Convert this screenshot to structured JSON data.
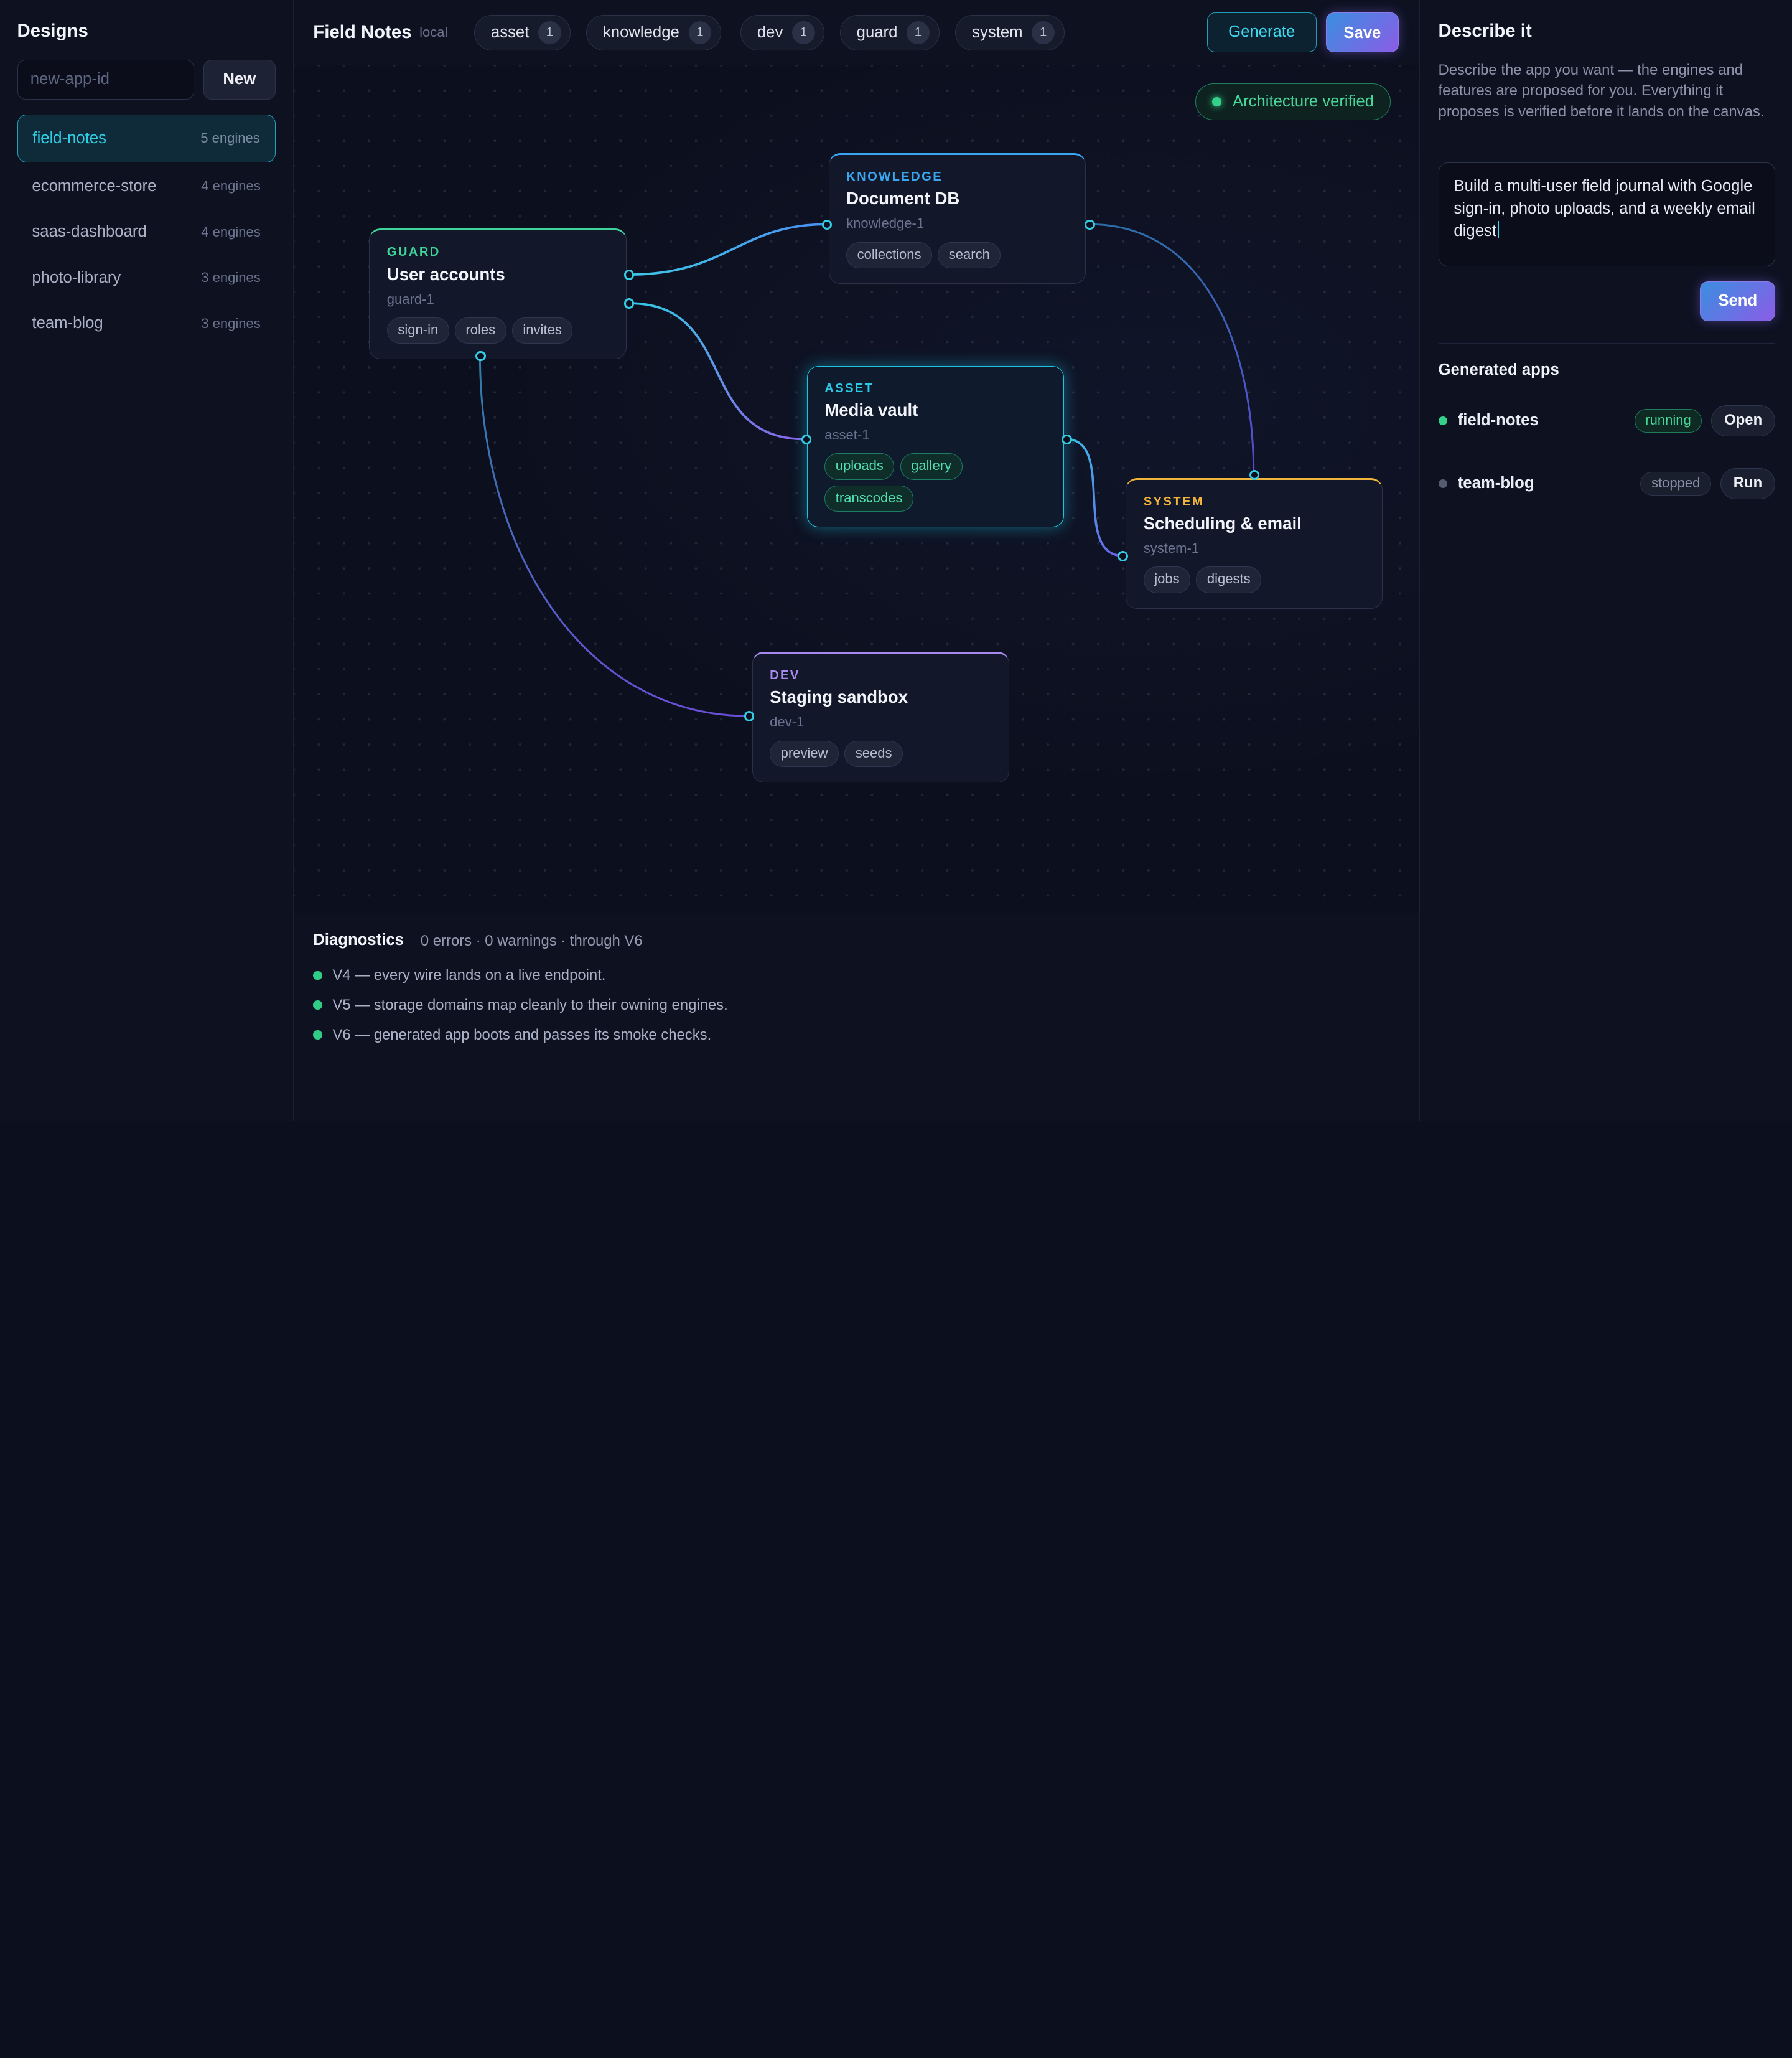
{
  "colors": {
    "guard": "#3fd49a",
    "knowledge": "#3aa6f0",
    "asset": "#2bc9e3",
    "system": "#f0b43a",
    "dev": "#a78af0"
  },
  "sidebar": {
    "title": "Designs",
    "new_placeholder": "new-app-id",
    "new_label": "New",
    "items": [
      {
        "name": "field-notes",
        "count": "5 engines"
      },
      {
        "name": "ecommerce-store",
        "count": "4 engines"
      },
      {
        "name": "saas-dashboard",
        "count": "4 engines"
      },
      {
        "name": "photo-library",
        "count": "3 engines"
      },
      {
        "name": "team-blog",
        "count": "3 engines"
      }
    ]
  },
  "header": {
    "title": "Field Notes",
    "tag": "local",
    "chips": [
      {
        "label": "asset",
        "count": "1"
      },
      {
        "label": "knowledge",
        "count": "1"
      },
      {
        "label": "dev",
        "count": "1"
      },
      {
        "label": "guard",
        "count": "1"
      },
      {
        "label": "system",
        "count": "1"
      }
    ],
    "generate_label": "Generate",
    "save_label": "Save"
  },
  "canvas": {
    "verified_label": "Architecture verified",
    "nodes": {
      "guard": {
        "kind": "GUARD",
        "name": "User accounts",
        "id": "guard-1",
        "tags": [
          "sign-in",
          "roles",
          "invites"
        ]
      },
      "knowledge": {
        "kind": "KNOWLEDGE",
        "name": "Document DB",
        "id": "knowledge-1",
        "tags": [
          "collections",
          "search"
        ]
      },
      "asset": {
        "kind": "ASSET",
        "name": "Media vault",
        "id": "asset-1",
        "tags": [
          "uploads",
          "gallery",
          "transcodes"
        ]
      },
      "system": {
        "kind": "SYSTEM",
        "name": "Scheduling & email",
        "id": "system-1",
        "tags": [
          "jobs",
          "digests"
        ]
      },
      "dev": {
        "kind": "DEV",
        "name": "Staging sandbox",
        "id": "dev-1",
        "tags": [
          "preview",
          "seeds"
        ]
      }
    }
  },
  "diagnostics": {
    "title": "Diagnostics",
    "summary": "0 errors · 0 warnings · through V6",
    "items": [
      "V4 — every wire lands on a live endpoint.",
      "V5 — storage domains map cleanly to their owning engines.",
      "V6 — generated app boots and passes its smoke checks."
    ]
  },
  "panel": {
    "title": "Describe it",
    "description": "Describe the app you want — the engines and features are proposed for you. Everything it proposes is verified before it lands on the canvas.",
    "prompt": "Build a multi-user field journal with Google sign-in, photo uploads, and a weekly email digest",
    "send_label": "Send",
    "generated_title": "Generated apps",
    "apps": [
      {
        "name": "field-notes",
        "status": "running",
        "action": "Open"
      },
      {
        "name": "team-blog",
        "status": "stopped",
        "action": "Run"
      }
    ]
  }
}
